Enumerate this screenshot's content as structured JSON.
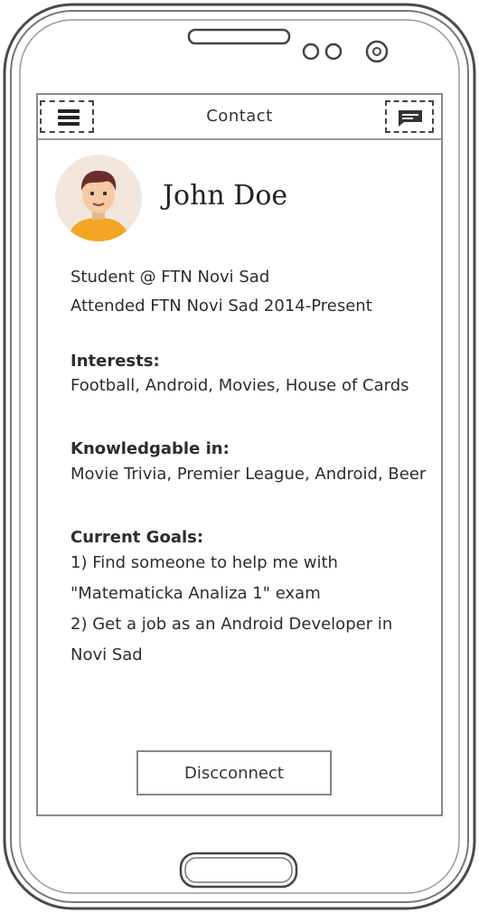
{
  "appbar": {
    "title": "Contact",
    "menu_icon": "hamburger-menu-icon",
    "message_icon": "message-icon"
  },
  "profile": {
    "name": "John Doe",
    "avatar_icon": "user-avatar-icon",
    "line1": "Student @ FTN Novi Sad",
    "line2": "Attended FTN Novi Sad 2014-Present"
  },
  "interests": {
    "heading": "Interests:",
    "text": "Football, Android, Movies, House of Cards"
  },
  "knowledgeable": {
    "heading": "Knowledgable in:",
    "text": "Movie Trivia, Premier League, Android, Beer"
  },
  "goals": {
    "heading": "Current Goals:",
    "line1": "1) Find someone to help me with",
    "line2": "\"Matematicka Analiza 1\" exam",
    "line3": "2) Get a job as an Android Developer in",
    "line4": "Novi Sad"
  },
  "actions": {
    "disconnect_label": "Discconnect"
  },
  "colors": {
    "frame": "#555555",
    "avatar_bg": "#f3e6dc",
    "shirt": "#f2a623",
    "hair": "#6b2e2e",
    "skin": "#f5c9a4"
  }
}
